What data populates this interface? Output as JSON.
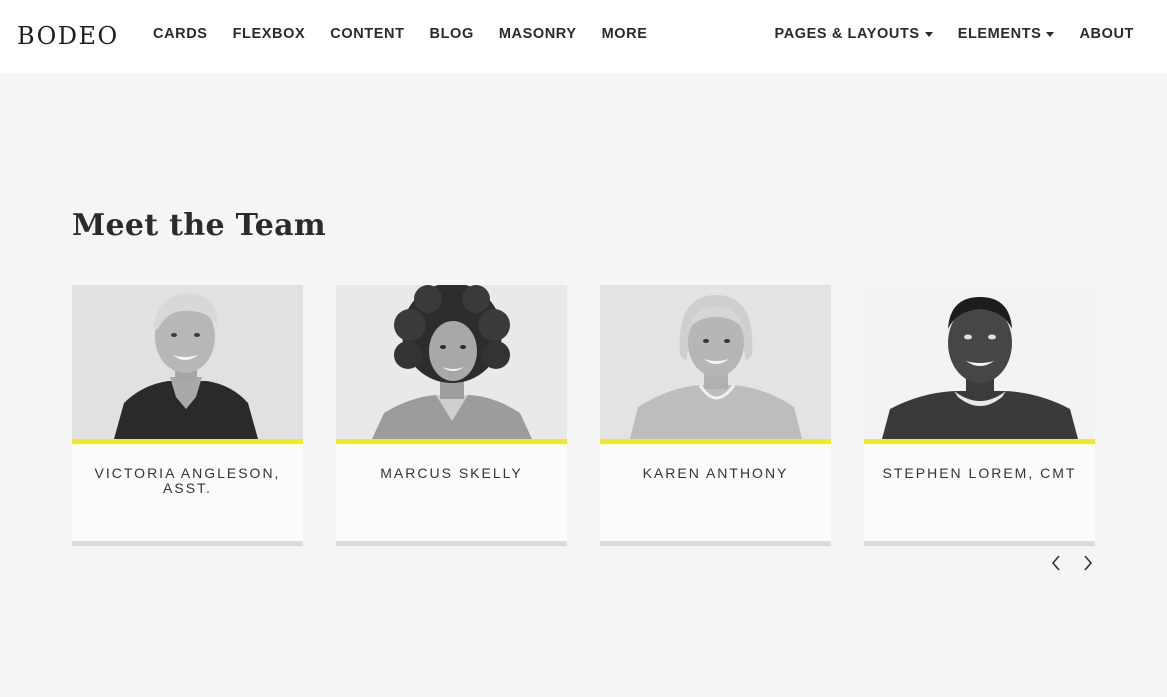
{
  "brand": "BODEO",
  "nav": {
    "left": [
      "CARDS",
      "FLEXBOX",
      "CONTENT",
      "BLOG",
      "MASONRY",
      "MORE"
    ],
    "right": [
      {
        "label": "PAGES & LAYOUTS",
        "dropdown": true
      },
      {
        "label": "ELEMENTS",
        "dropdown": true
      },
      {
        "label": "ABOUT",
        "dropdown": false
      }
    ]
  },
  "section": {
    "title": "Meet the Team"
  },
  "team": [
    {
      "name": "VICTORIA ANGLESON, ASST.",
      "photo": "woman-short-blonde-hair-photo"
    },
    {
      "name": "MARCUS SKELLY",
      "photo": "man-curly-hair-photo"
    },
    {
      "name": "KAREN ANTHONY",
      "photo": "older-woman-bob-hair-photo"
    },
    {
      "name": "STEPHEN LOREM, CMT",
      "photo": "man-sweater-photo"
    }
  ],
  "carousel": {
    "prev_icon": "chevron-left-icon",
    "next_icon": "chevron-right-icon"
  },
  "colors": {
    "accent": "#f4ea14",
    "page_bg": "#f4f5f4",
    "card_bg": "#fbfbfb",
    "card_shadow": "#dadada"
  }
}
